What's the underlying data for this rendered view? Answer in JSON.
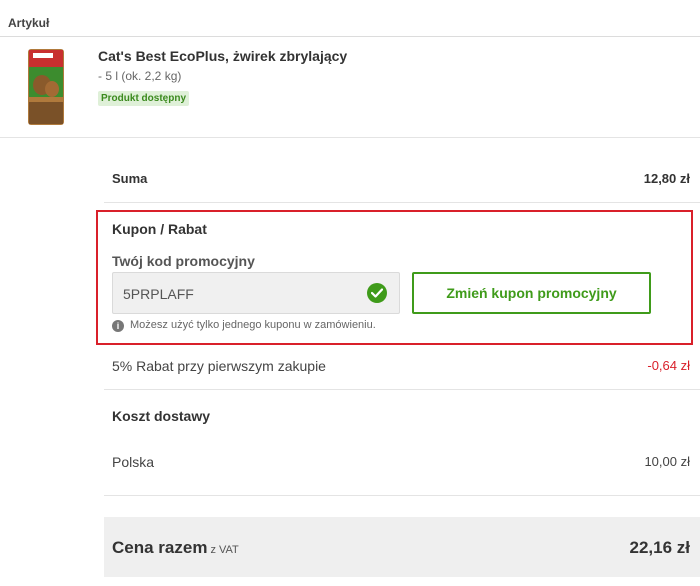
{
  "table_header": {
    "article_label": "Artykuł"
  },
  "item": {
    "name": "Cat's Best EcoPlus, żwirek zbrylający",
    "variant": "- 5 l (ok. 2,2 kg)",
    "availability": "Produkt dostępny"
  },
  "summary": {
    "sum_label": "Suma",
    "sum_value": "12,80 zł"
  },
  "coupon": {
    "title": "Kupon / Rabat",
    "field_label": "Twój kod promocyjny",
    "code_value": "5PRPLAFF",
    "change_button": "Zmień kupon promocyjny",
    "note": "Możesz użyć tylko jednego kuponu w zamówieniu."
  },
  "discount": {
    "label": "5% Rabat przy pierwszym zakupie",
    "value": "-0,64 zł"
  },
  "shipping": {
    "title": "Koszt dostawy",
    "country": "Polska",
    "value": "10,00 zł"
  },
  "total": {
    "label": "Cena razem",
    "vat_note": "z VAT",
    "value": "22,16 zł"
  },
  "colors": {
    "accent_green": "#3f9b1a",
    "highlight_red": "#d9202a",
    "discount_red": "#d9202a"
  }
}
